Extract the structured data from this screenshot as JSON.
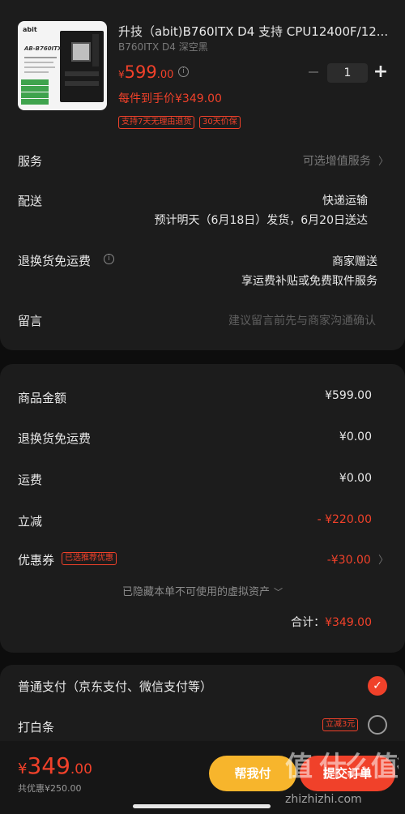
{
  "product": {
    "image_brand": "abit",
    "image_model": "AB-B760ITX",
    "title": "升技（abit)B760ITX D4 支持 CPU12400F/12...",
    "variant": "B760ITX D4 深空黑",
    "price_symbol": "¥",
    "price_int": "599",
    "price_dec": ".00",
    "final_price": "每件到手价¥349.00",
    "quantity": "1",
    "tags": [
      "支持7天无理由退货",
      "30天价保"
    ]
  },
  "service": {
    "label": "服务",
    "value": "可选增值服务"
  },
  "delivery": {
    "label": "配送",
    "method": "快递运输",
    "eta": "预计明天（6月18日）发货，6月20日送达"
  },
  "return_shipping": {
    "label": "退换货免运费",
    "value1": "商家赠送",
    "value2": "享运费补贴或免费取件服务"
  },
  "note": {
    "label": "留言",
    "placeholder": "建议留言前先与商家沟通确认"
  },
  "summary": {
    "rows": [
      {
        "label": "商品金额",
        "value": "¥599.00"
      },
      {
        "label": "退换货免运费",
        "value": "¥0.00"
      },
      {
        "label": "运费",
        "value": "¥0.00"
      },
      {
        "label": "立减",
        "value": "- ¥220.00"
      },
      {
        "label": "优惠券",
        "value": "-¥30.00",
        "tag": "已选推荐优惠"
      }
    ],
    "hidden_assets": "已隐藏本单不可使用的虚拟资产",
    "total_label": "合计：",
    "total_value": "¥349.00"
  },
  "payment": {
    "normal_label": "普通支付（京东支付、微信支付等）",
    "baitiao_label": "打白条",
    "baitiao_tag": "立减3元"
  },
  "bottom": {
    "price_symbol": "¥",
    "price_int": "349",
    "price_dec": ".00",
    "discount_text": "共优惠¥250.00",
    "help_button": "帮我付",
    "submit_button": "提交订单"
  },
  "watermark": "值 什么值得买",
  "watermark_url": "zhizhizhi.com",
  "colors": {
    "accent": "#f0412a",
    "help": "#f7b52c",
    "card": "#1c1c1c",
    "bg": "#0d0d0d"
  }
}
